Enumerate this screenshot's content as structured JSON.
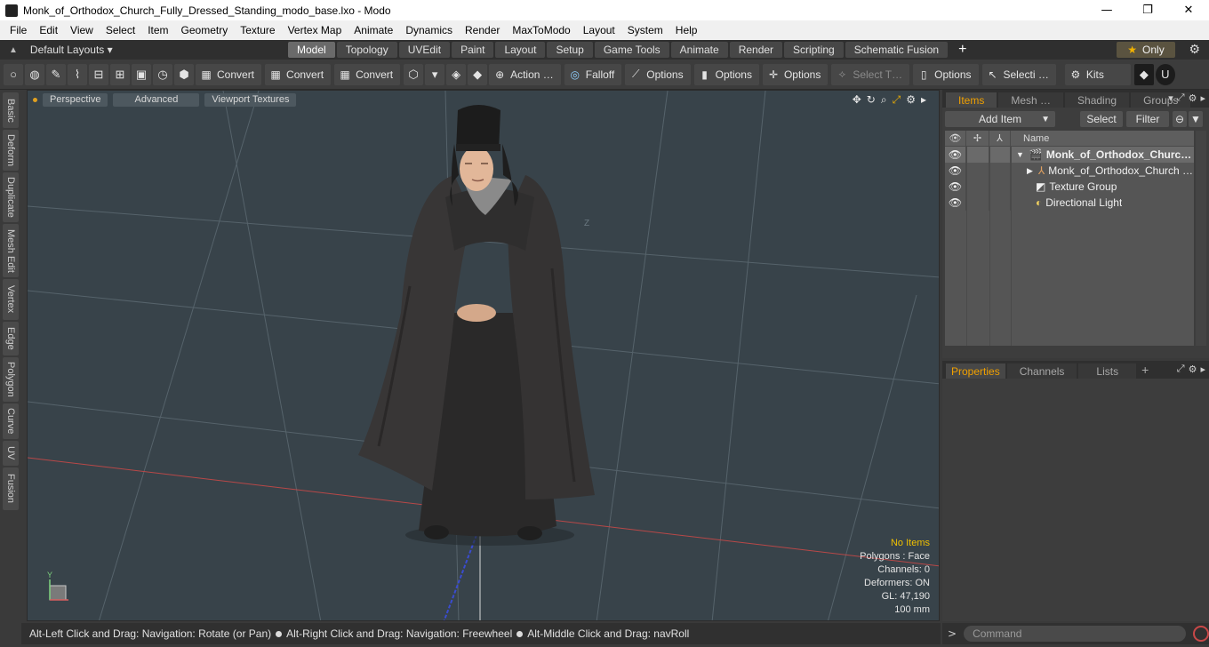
{
  "window": {
    "title": "Monk_of_Orthodox_Church_Fully_Dressed_Standing_modo_base.lxo - Modo",
    "minimize": "—",
    "maximize": "❐",
    "close": "✕"
  },
  "menu": [
    "File",
    "Edit",
    "View",
    "Select",
    "Item",
    "Geometry",
    "Texture",
    "Vertex Map",
    "Animate",
    "Dynamics",
    "Render",
    "MaxToModo",
    "Layout",
    "System",
    "Help"
  ],
  "layouts": {
    "label": "Default Layouts ▾",
    "tabs": [
      "Model",
      "Topology",
      "UVEdit",
      "Paint",
      "Layout",
      "Setup",
      "Game Tools",
      "Animate",
      "Render",
      "Scripting",
      "Schematic Fusion"
    ],
    "active_tab": "Model",
    "add": "+",
    "only_label": "Only"
  },
  "toolbar": {
    "convert1": "Convert",
    "convert2": "Convert",
    "convert3": "Convert",
    "action": "Action …",
    "falloff": "Falloff",
    "options1": "Options",
    "options2": "Options",
    "options3": "Options",
    "select_t": "Select T…",
    "options4": "Options",
    "selecti": "Selecti …",
    "kits": "Kits"
  },
  "left_tabs": [
    "Basic",
    "Deform",
    "Duplicate",
    "Mesh Edit",
    "Vertex",
    "Edge",
    "Polygon",
    "Curve",
    "UV",
    "Fusion"
  ],
  "viewport": {
    "chips": [
      "Perspective",
      "Advanced",
      "Viewport Textures"
    ],
    "info": {
      "selection": "No Items",
      "polygons": "Polygons : Face",
      "channels": "Channels: 0",
      "deformers": "Deformers: ON",
      "gl": "GL: 47,190",
      "scale": "100 mm"
    },
    "axis_y": "Y",
    "axis_z": "Z"
  },
  "status": {
    "part1": "Alt-Left Click and Drag: Navigation: Rotate (or Pan)",
    "part2": "Alt-Right Click and Drag: Navigation: Freewheel",
    "part3": "Alt-Middle Click and Drag: navRoll"
  },
  "items_panel": {
    "tabs": [
      "Items",
      "Mesh …",
      "Shading",
      "Groups"
    ],
    "active_tab": "Items",
    "add_item": "Add Item",
    "select": "Select",
    "filter": "Filter",
    "name_header": "Name",
    "rows": [
      {
        "name": "Monk_of_Orthodox_Churc…",
        "bold": true
      },
      {
        "name": "Monk_of_Orthodox_Church …",
        "bold": false
      },
      {
        "name": "Texture Group",
        "bold": false
      },
      {
        "name": "Directional Light",
        "bold": false
      }
    ]
  },
  "properties_panel": {
    "tabs": [
      "Properties",
      "Channels",
      "Lists"
    ],
    "active_tab": "Properties",
    "add": "+"
  },
  "command": {
    "arrow": ">",
    "placeholder": "Command"
  },
  "colors": {
    "accent": "#f0a000",
    "viewport_bg": "#38434a",
    "robe": "#2e2d2d"
  }
}
